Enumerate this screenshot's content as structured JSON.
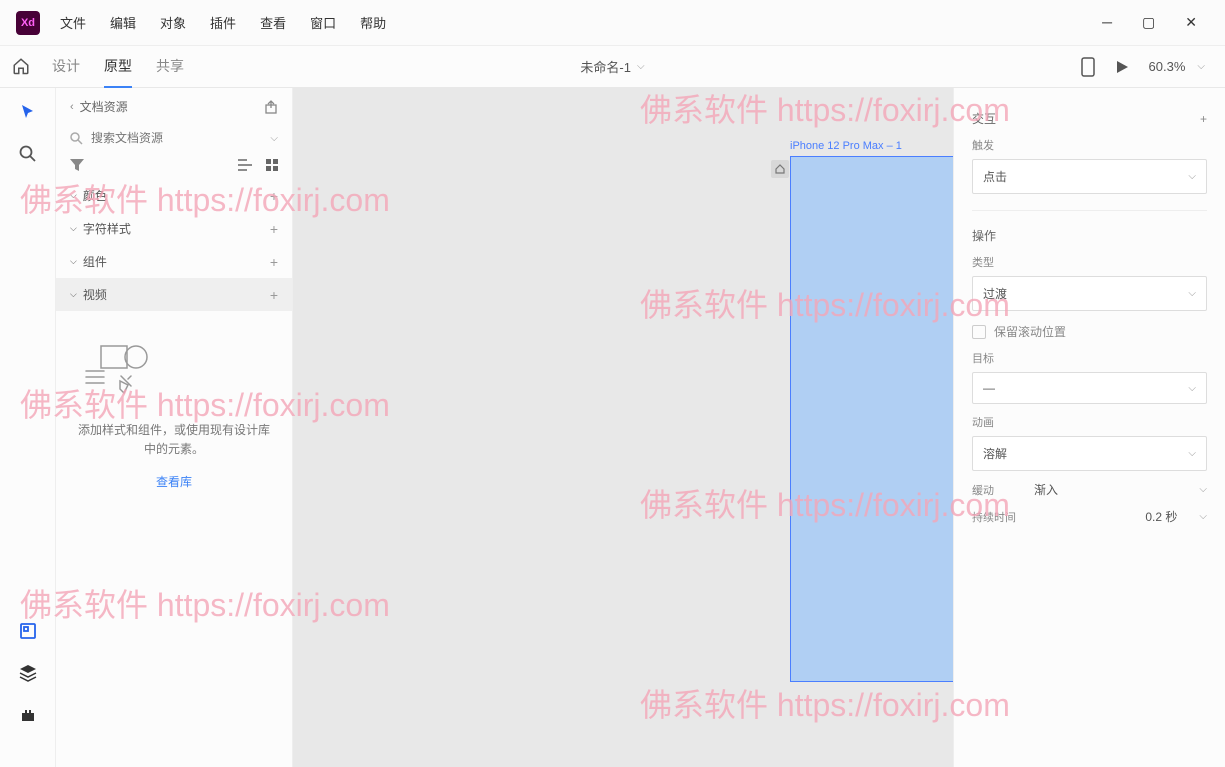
{
  "menu": {
    "file": "文件",
    "edit": "编辑",
    "object": "对象",
    "plugins": "插件",
    "view": "查看",
    "window": "窗口",
    "help": "帮助"
  },
  "tabs": {
    "design": "设计",
    "prototype": "原型",
    "share": "共享"
  },
  "document": {
    "title": "未命名-1"
  },
  "zoom": "60.3%",
  "leftPanel": {
    "title": "文档资源",
    "searchPlaceholder": "搜索文档资源",
    "sections": {
      "colors": "颜色",
      "charStyles": "字符样式",
      "components": "组件",
      "videos": "视频"
    },
    "emptyText": "添加样式和组件，或使用现有设计库中的元素。",
    "emptyLink": "查看库"
  },
  "canvas": {
    "artboardLabel": "iPhone 12 Pro Max – 1"
  },
  "rightPanel": {
    "interaction": "交互",
    "trigger": "触发",
    "triggerValue": "点击",
    "action": "操作",
    "type": "类型",
    "typeValue": "过渡",
    "preserveScroll": "保留滚动位置",
    "destination": "目标",
    "destinationValue": "—",
    "animation": "动画",
    "animationValue": "溶解",
    "easing": "缓动",
    "easingValue": "渐入",
    "duration": "持续时间",
    "durationValue": "0.2 秒"
  },
  "watermark": "佛系软件 https://foxirj.com"
}
